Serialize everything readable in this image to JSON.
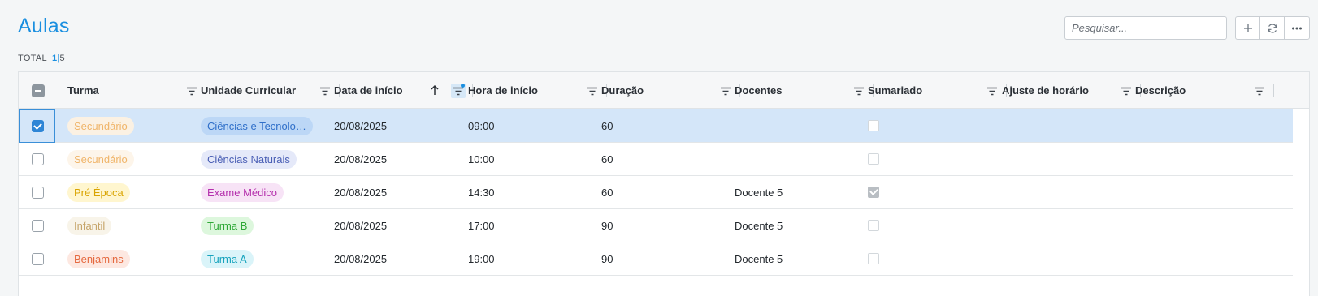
{
  "page": {
    "title": "Aulas"
  },
  "total": {
    "label": "TOTAL",
    "selected": "1",
    "separator": "|",
    "count": "5"
  },
  "search": {
    "placeholder": "Pesquisar..."
  },
  "toolbar": {
    "add_icon": "plus-icon",
    "refresh_icon": "refresh-icon",
    "more_icon": "more-icon"
  },
  "columns": [
    {
      "label": "Turma"
    },
    {
      "label": "Unidade Curricular"
    },
    {
      "label": "Data de início",
      "sort": "ascending",
      "filter_active": true
    },
    {
      "label": "Hora de início"
    },
    {
      "label": "Duração"
    },
    {
      "label": "Docentes"
    },
    {
      "label": "Sumariado"
    },
    {
      "label": "Ajuste de horário"
    },
    {
      "label": "Descrição"
    }
  ],
  "rows": [
    {
      "selected": true,
      "turma": "Secundário",
      "turma_bg": "#fbf1e3",
      "turma_fg": "#f0b56a",
      "uc": "Ciências e Tecnolo…",
      "uc_bg": "#bcd7f6",
      "uc_fg": "#2f6fc9",
      "data": "20/08/2025",
      "hora": "09:00",
      "duracao": "60",
      "docentes": "",
      "sumariado": false
    },
    {
      "selected": false,
      "turma": "Secundário",
      "turma_bg": "#fdf5ea",
      "turma_fg": "#f0b56a",
      "uc": "Ciências Naturais",
      "uc_bg": "#e5e9f9",
      "uc_fg": "#4a5fb5",
      "data": "20/08/2025",
      "hora": "10:00",
      "duracao": "60",
      "docentes": "",
      "sumariado": false
    },
    {
      "selected": false,
      "turma": "Pré Época",
      "turma_bg": "#fff6cf",
      "turma_fg": "#d9a400",
      "uc": "Exame Médico",
      "uc_bg": "#f7e3f6",
      "uc_fg": "#b531ad",
      "data": "20/08/2025",
      "hora": "14:30",
      "duracao": "60",
      "docentes": "Docente 5",
      "sumariado": true
    },
    {
      "selected": false,
      "turma": "Infantil",
      "turma_bg": "#f8f4e9",
      "turma_fg": "#c6a56a",
      "uc": "Turma B",
      "uc_bg": "#ddf7dd",
      "uc_fg": "#2fa837",
      "data": "20/08/2025",
      "hora": "17:00",
      "duracao": "90",
      "docentes": "Docente 5",
      "sumariado": false
    },
    {
      "selected": false,
      "turma": "Benjamins",
      "turma_bg": "#fde8e1",
      "turma_fg": "#e5693f",
      "uc": "Turma A",
      "uc_bg": "#daf4f9",
      "uc_fg": "#17a3bd",
      "data": "20/08/2025",
      "hora": "19:00",
      "duracao": "90",
      "docentes": "Docente 5",
      "sumariado": false
    }
  ]
}
